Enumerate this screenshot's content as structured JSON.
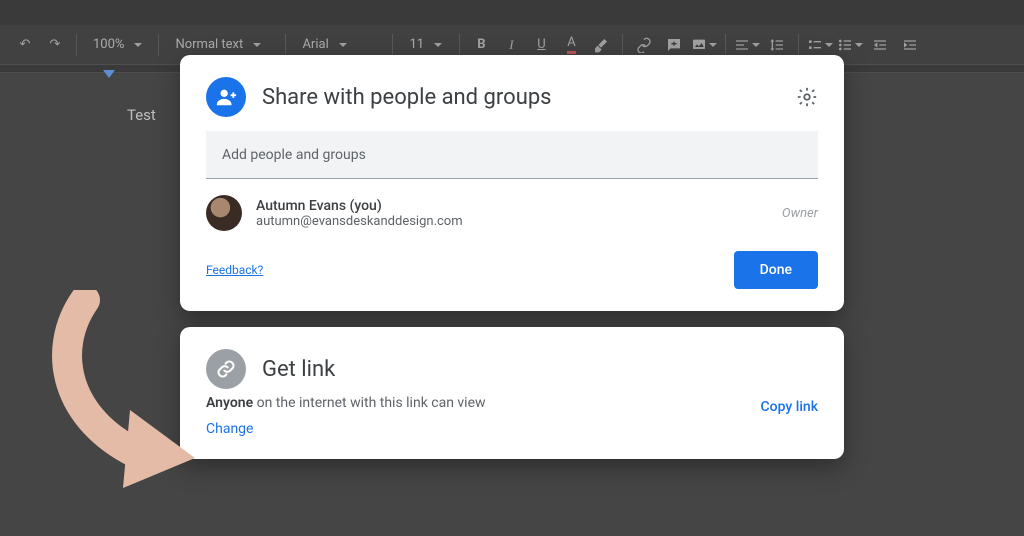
{
  "toolbar": {
    "zoom": "100%",
    "style": "Normal text",
    "font": "Arial",
    "size": "11"
  },
  "document": {
    "body_text": "Test"
  },
  "share": {
    "title": "Share with people and groups",
    "input_placeholder": "Add people and groups",
    "member": {
      "name": "Autumn Evans (you)",
      "email": "autumn@evansdeskanddesign.com",
      "role": "Owner"
    },
    "feedback_label": "Feedback?",
    "done_label": "Done"
  },
  "getlink": {
    "title": "Get link",
    "desc_bold": "Anyone",
    "desc_rest": " on the internet with this link can view",
    "change_label": "Change",
    "copy_label": "Copy link"
  }
}
